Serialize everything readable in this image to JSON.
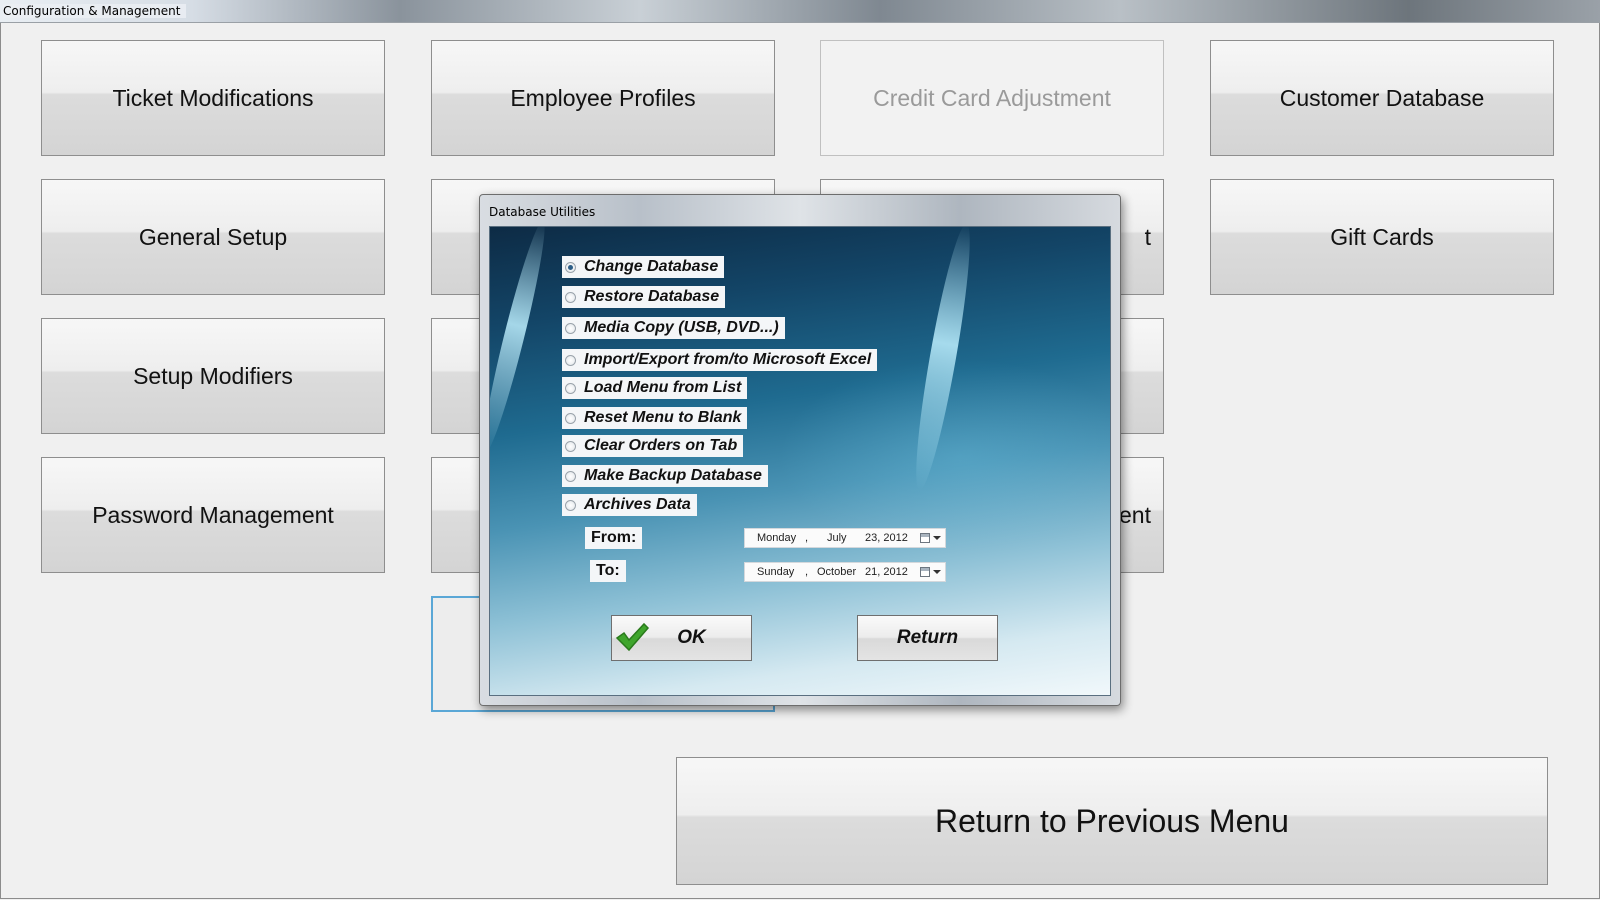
{
  "window": {
    "title": "Configuration & Management"
  },
  "tiles": {
    "ticket_modifications": "Ticket Modifications",
    "employee_profiles": "Employee Profiles",
    "credit_card_adjustment": "Credit Card Adjustment",
    "customer_database": "Customer Database",
    "general_setup": "General Setup",
    "gift_cards": "Gift Cards",
    "setup_modifiers": "Setup Modifiers",
    "password_management": "Password Management",
    "partial_right_row2": "t",
    "partial_right_row4": "ent",
    "return_to_previous_menu": "Return to Previous Menu"
  },
  "dialog": {
    "title": "Database Utilities",
    "options": [
      {
        "label": "Change Database",
        "checked": true
      },
      {
        "label": "Restore Database",
        "checked": false
      },
      {
        "label": "Media Copy (USB, DVD...)",
        "checked": false
      },
      {
        "label": "Import/Export from/to Microsoft Excel",
        "checked": false
      },
      {
        "label": "Load Menu from List",
        "checked": false
      },
      {
        "label": "Reset Menu to Blank",
        "checked": false
      },
      {
        "label": "Clear Orders on Tab",
        "checked": false
      },
      {
        "label": "Make Backup Database",
        "checked": false
      },
      {
        "label": "Archives Data",
        "checked": false
      }
    ],
    "from": {
      "label": "From:",
      "weekday": "Monday",
      "sep": ",",
      "month": "July",
      "day_year": "23, 2012"
    },
    "to": {
      "label": "To:",
      "weekday": "Sunday",
      "sep": ",",
      "month": "October",
      "day_year": "21, 2012"
    },
    "ok_label": "OK",
    "return_label": "Return"
  },
  "icons": {
    "calendar": "calendar-icon",
    "dropdown": "chevron-down-icon",
    "ok": "checkmark-icon"
  },
  "colors": {
    "focus_border": "#5aa7d6",
    "disabled_text": "#9a9a9a",
    "dialog_bg_dark": "#0d2b45",
    "dialog_bg_light": "#f1f8fb",
    "check_green": "#3fa52c"
  }
}
